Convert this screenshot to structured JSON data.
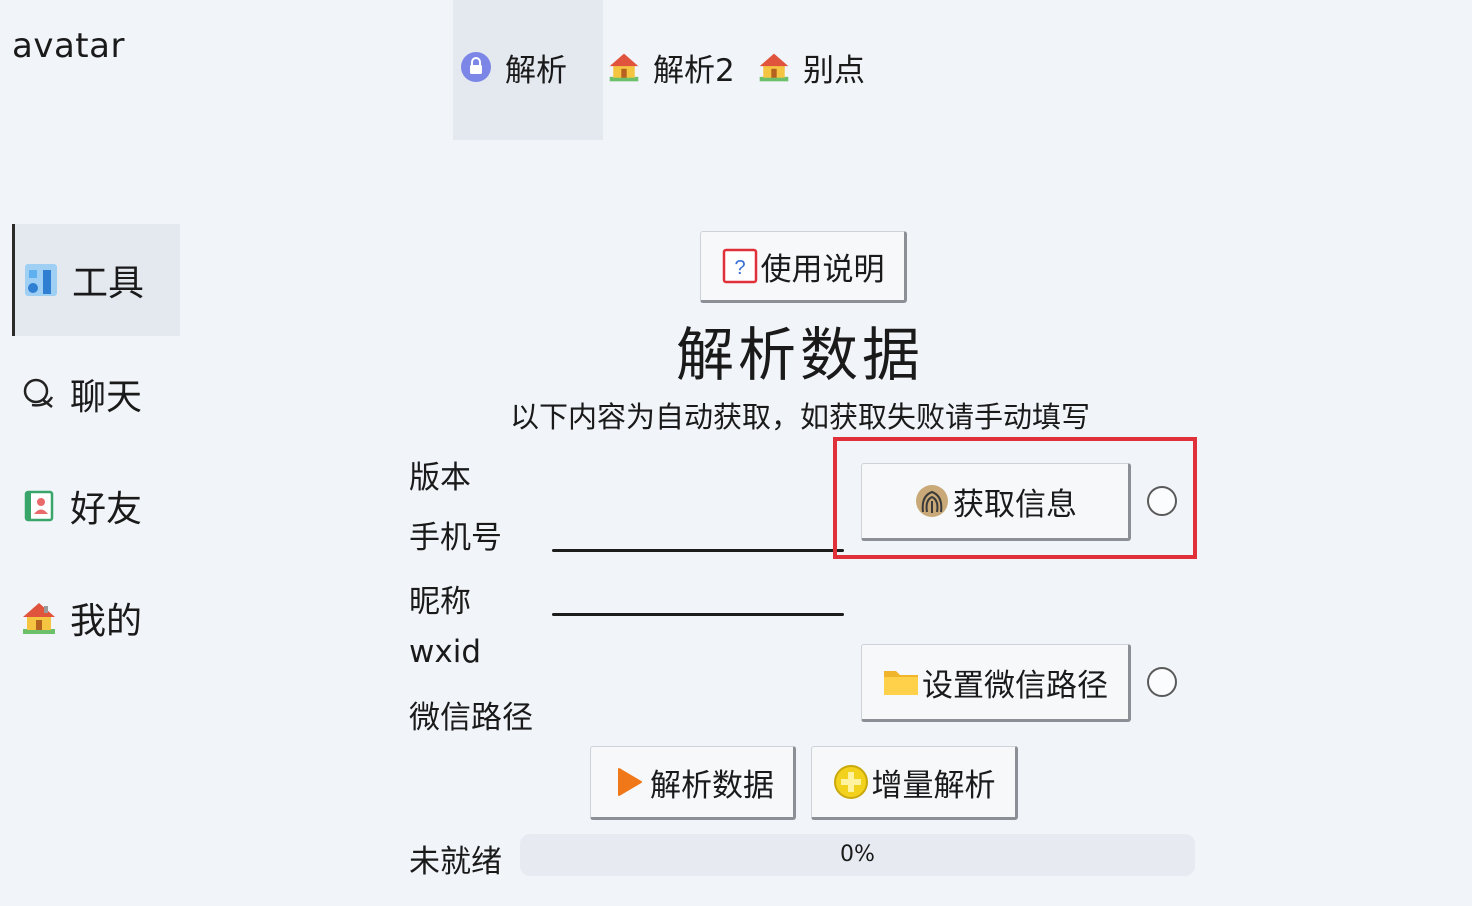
{
  "sidebar": {
    "avatar_label": "avatar",
    "items": [
      {
        "label": "工具",
        "icon": "tools-icon"
      },
      {
        "label": "聊天",
        "icon": "chat-icon"
      },
      {
        "label": "好友",
        "icon": "contacts-icon"
      },
      {
        "label": "我的",
        "icon": "house-icon"
      }
    ]
  },
  "tabs": [
    {
      "label": "解析",
      "icon": "lock-icon"
    },
    {
      "label": "解析2",
      "icon": "house-icon"
    },
    {
      "label": "别点",
      "icon": "house-icon"
    }
  ],
  "main": {
    "help_button": "使用说明",
    "title": "解析数据",
    "subtitle": "以下内容为自动获取，如获取失败请手动填写",
    "fields": {
      "version": "版本",
      "phone": "手机号",
      "nickname": "昵称",
      "wxid": "wxid",
      "wechat_path": "微信路径"
    },
    "get_info_button": "获取信息",
    "set_path_button": "设置微信路径",
    "parse_button": "解析数据",
    "incremental_button": "增量解析",
    "status_text": "未就绪",
    "progress_text": "0%",
    "progress_value": 0
  },
  "colors": {
    "background": "#f1f4f9",
    "highlight_border": "#e0303a",
    "play_icon": "#f07818",
    "plus_icon": "#f2d21c"
  }
}
